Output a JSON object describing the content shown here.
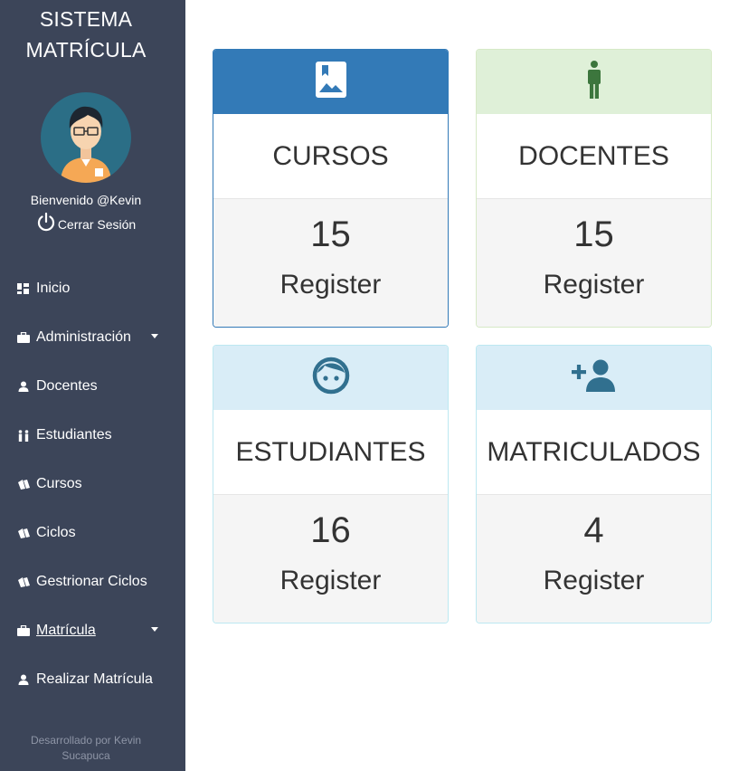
{
  "sidebar": {
    "brand_line1": "SISTEMA",
    "brand_line2": "MATRÍCULA",
    "avatar_icon": "user-avatar-icon",
    "welcome": "Bienvenido @Kevin",
    "logout": "Cerrar Sesión",
    "items": [
      {
        "label": "Inicio",
        "icon": "dashboard-icon"
      },
      {
        "label": "Administración",
        "icon": "briefcase-icon",
        "dropdown": true
      },
      {
        "label": "Docentes",
        "icon": "user-icon"
      },
      {
        "label": "Estudiantes",
        "icon": "people-icon"
      },
      {
        "label": "Cursos",
        "icon": "books-icon"
      },
      {
        "label": "Ciclos",
        "icon": "books-icon"
      },
      {
        "label": "Gestrionar Ciclos",
        "icon": "books-icon"
      },
      {
        "label": "Matrícula",
        "icon": "briefcase-icon",
        "dropdown": true
      },
      {
        "label": "Realizar Matrícula",
        "icon": "user-icon"
      }
    ],
    "footer_line1": "Desarrollado por Kevin",
    "footer_line2": "Sucapuca"
  },
  "cards": [
    {
      "title": "CURSOS",
      "count": "15",
      "label": "Register",
      "icon": "image-bookmark-icon",
      "color": "#337ab7"
    },
    {
      "title": "DOCENTES",
      "count": "15",
      "label": "Register",
      "icon": "person-standing-icon",
      "color": "#dff0d8"
    },
    {
      "title": "ESTUDIANTES",
      "count": "16",
      "label": "Register",
      "icon": "child-face-icon",
      "color": "#d9edf7"
    },
    {
      "title": "MATRICULADOS",
      "count": "4",
      "label": "Register",
      "icon": "add-user-icon",
      "color": "#d9edf7"
    }
  ]
}
